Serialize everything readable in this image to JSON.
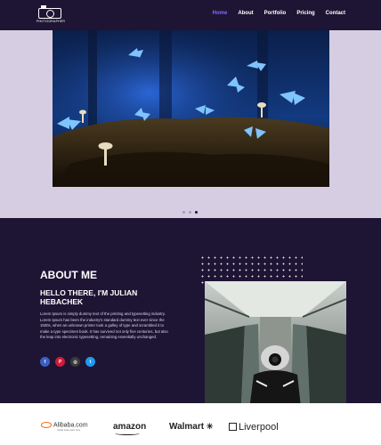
{
  "header": {
    "logo_text": "PHOTOGRAPHER",
    "menu": [
      {
        "label": "Home",
        "active": true
      },
      {
        "label": "About"
      },
      {
        "label": "Portfolio"
      },
      {
        "label": "Pricing"
      },
      {
        "label": "Contact"
      }
    ]
  },
  "hero": {
    "image": "butterflies-forest-photo",
    "slides": 3,
    "active_slide": 3
  },
  "about": {
    "title": "ABOUT ME",
    "subtitle": "HELLO THERE, I'M JULIAN HEBACHEK",
    "body": "Lorem Ipsum is simply dummy text of the printing and typesetting industry. Lorem Ipsum has been the industry's standard dummy text ever since the 1500s, when an unknown printer took a galley of type and scrambled it to make a type specimen book. It has survived not only five centuries, but also the leap into electronic typesetting, remaining essentially unchanged.",
    "socials": [
      "facebook-icon",
      "pinterest-icon",
      "instagram-icon",
      "twitter-icon"
    ],
    "photo": "person-with-camera-escalator-photo"
  },
  "brands": {
    "alibaba": "Alibaba.com",
    "alibaba_tag": "Global trade starts here",
    "amazon": "amazon",
    "walmart": "Walmart",
    "liverpool": "Liverpool"
  },
  "colors": {
    "dark": "#1e1534",
    "hero_bg": "#d6cde3",
    "accent": "#7d6bff"
  }
}
